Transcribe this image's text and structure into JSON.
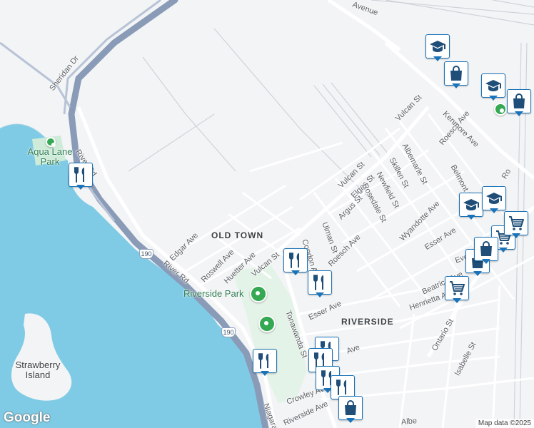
{
  "map": {
    "colors": {
      "water": "#7fcbe5",
      "land": "#f3f4f6",
      "highway": "#8a9bb8",
      "road": "#ffffff",
      "park": "#cdebd8",
      "pin_border": "#1a73b8"
    },
    "neighborhoods": [
      "OLD TOWN",
      "RIVERSIDE"
    ],
    "parks": [
      "Aqua Lane Park",
      "Riverside Park"
    ],
    "island": "Strawberry Island",
    "streets": [
      "Sheridan Dr",
      "River Rd",
      "Edgar Ave",
      "Roswell Ave",
      "Huetter Ave",
      "Vulcan St",
      "River Rd",
      "Condon Ave",
      "Roesch Ave",
      "Ulman St",
      "Tonawanda St",
      "Esser Ave",
      "Argus St",
      "Elgas St",
      "Rosedale St",
      "Newfield St",
      "Skillen St",
      "Albemarle St",
      "Roesch Ave",
      "Belmont St",
      "Kenmore Ave",
      "Wyandotte Ave",
      "Esser Ave",
      "Henrietta Ave",
      "Beatrice Ave",
      "Ontario St",
      "Isabelle St",
      "Crowley Ave",
      "Riverside Ave",
      "Niagara",
      "Vulcan St",
      "Eve",
      "Ave",
      "Albe",
      "Avenue",
      "Vulcan St",
      "Ro"
    ],
    "shields": [
      "190",
      "190"
    ],
    "pins": [
      {
        "type": "school",
        "icon": "school-icon"
      },
      {
        "type": "shopping",
        "icon": "shopping-bag-icon"
      },
      {
        "type": "school",
        "icon": "school-icon"
      },
      {
        "type": "shopping",
        "icon": "shopping-bag-icon"
      },
      {
        "type": "restaurant",
        "icon": "restaurant-icon"
      },
      {
        "type": "restaurant",
        "icon": "restaurant-icon"
      },
      {
        "type": "restaurant",
        "icon": "restaurant-icon"
      },
      {
        "type": "restaurant",
        "icon": "restaurant-icon"
      },
      {
        "type": "school",
        "icon": "school-icon"
      },
      {
        "type": "school",
        "icon": "school-icon"
      },
      {
        "type": "shopping",
        "icon": "shopping-bag-icon"
      },
      {
        "type": "grocery",
        "icon": "shopping-cart-icon"
      },
      {
        "type": "grocery",
        "icon": "shopping-cart-icon"
      },
      {
        "type": "shopping",
        "icon": "shopping-bag-icon"
      },
      {
        "type": "grocery",
        "icon": "shopping-cart-icon"
      },
      {
        "type": "restaurant",
        "icon": "restaurant-icon"
      },
      {
        "type": "restaurant",
        "icon": "restaurant-icon"
      },
      {
        "type": "restaurant",
        "icon": "restaurant-icon"
      },
      {
        "type": "restaurant",
        "icon": "restaurant-icon"
      },
      {
        "type": "shopping",
        "icon": "shopping-bag-icon"
      }
    ],
    "attribution": "Map data ©2025",
    "logo": "Google"
  }
}
